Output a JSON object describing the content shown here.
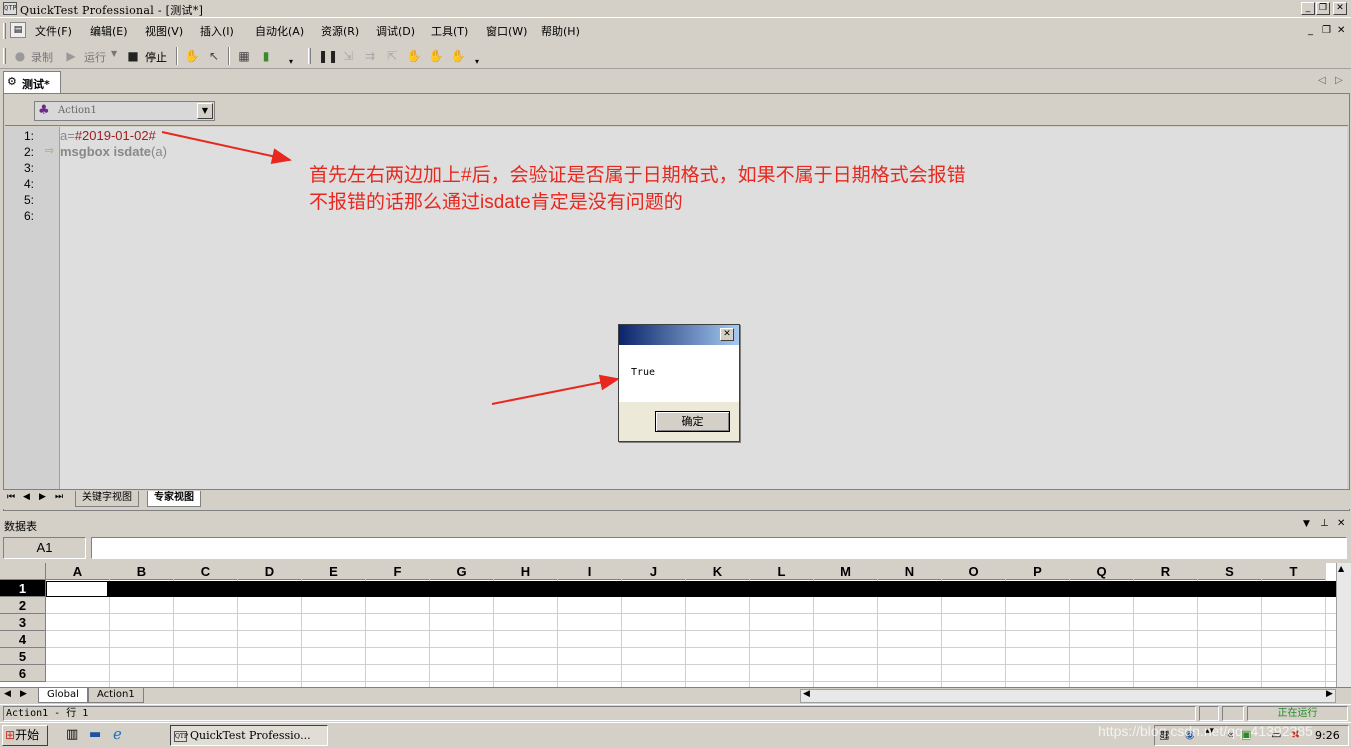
{
  "window": {
    "title": "QuickTest Professional - [测试*]",
    "app_icon_text": "QTP"
  },
  "menu": [
    "文件(F)",
    "编辑(E)",
    "视图(V)",
    "插入(I)",
    "自动化(A)",
    "资源(R)",
    "调试(D)",
    "工具(T)",
    "窗口(W)",
    "帮助(H)"
  ],
  "toolbar": {
    "record_label": "录制",
    "run_label": "运行",
    "stop_label": "停止"
  },
  "document_tab": "测试*",
  "action_selector": {
    "value": "Action1"
  },
  "editor": {
    "line_numbers": [
      "1:",
      "2:",
      "3:",
      "4:",
      "5:",
      "6:"
    ],
    "line1": {
      "var": "a",
      "op": "=",
      "value": "#2019-01-02#"
    },
    "line2": {
      "keyword": "msgbox isdate",
      "arg": "(a)"
    }
  },
  "annotation": {
    "line1": "首先左右两边加上#后，会验证是否属于日期格式，如果不属于日期格式会报错",
    "line2": "不报错的话那么通过isdate肯定是没有问题的",
    "color": "#e8281e"
  },
  "msgbox": {
    "message": "True",
    "ok_label": "确定"
  },
  "view_tabs": [
    "关键字视图",
    "专家视图"
  ],
  "datatable": {
    "panel_title": "数据表",
    "cell_ref": "A1",
    "columns": [
      "A",
      "B",
      "C",
      "D",
      "E",
      "F",
      "G",
      "H",
      "I",
      "J",
      "K",
      "L",
      "M",
      "N",
      "O",
      "P",
      "Q",
      "R",
      "S",
      "T"
    ],
    "rows": [
      "1",
      "2",
      "3",
      "4",
      "5",
      "6"
    ],
    "sheet_tabs": [
      "Global",
      "Action1"
    ]
  },
  "statusbar": {
    "left": "Action1  - 行  1",
    "right": "正在运行"
  },
  "taskbar": {
    "start_label": "开始",
    "task_label": "QuickTest Professio...",
    "clock": "9:26",
    "watermark": "https://blog.csdn.net/qq_41392385"
  }
}
